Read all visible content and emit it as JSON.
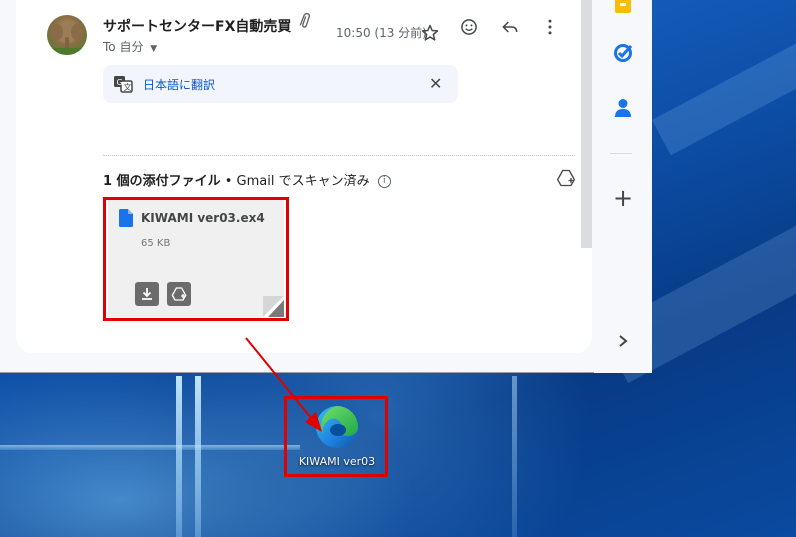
{
  "email": {
    "sender": "サポートセンターFX自動売買",
    "to_label": "To 自分",
    "time": "10:50 (13 分前)"
  },
  "translate": {
    "label": "日本語に翻訳"
  },
  "attachments": {
    "count_label": "1 個の添付ファイル",
    "separator": " • ",
    "scan_label": "Gmail でスキャン済み",
    "file": {
      "name": "KIWAMI ver03.ex4",
      "size": "65 KB"
    }
  },
  "desktop": {
    "shortcut_label": "KIWAMI ver03"
  },
  "colors": {
    "annotation_red": "#e00000",
    "gmail_blue": "#0b57d0",
    "file_icon_blue": "#1a73e8",
    "desktop_blue": "#0d4fa8"
  },
  "icons": {
    "header": [
      "attachment-icon",
      "star-icon",
      "emoji-icon",
      "reply-icon",
      "more-vert-icon"
    ],
    "rail": [
      "keep-icon",
      "tasks-icon",
      "contacts-icon",
      "add-icon",
      "expand-icon"
    ]
  }
}
